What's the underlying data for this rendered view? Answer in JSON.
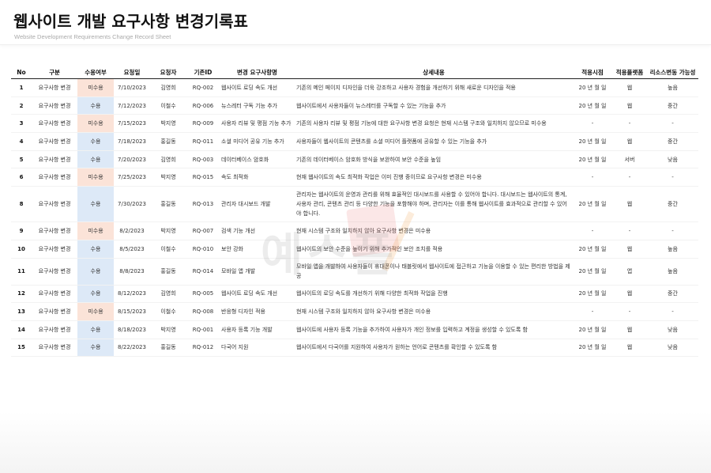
{
  "header": {
    "title": "웹사이트 개발 요구사항 변경기록표",
    "subtitle": "Website Development Requirements Change Record Sheet"
  },
  "watermark": {
    "icon": "yes-form-watermark-logo",
    "text": "예스폼"
  },
  "columns": [
    "No",
    "구분",
    "수용여부",
    "요청일",
    "요청자",
    "기존ID",
    "변경 요구사항명",
    "상세내용",
    "적용시점",
    "적용플랫폼",
    "리소스변동 가능성"
  ],
  "colors": {
    "accepted": "#dde9f7",
    "rejected": "#fbe3d8"
  },
  "rows": [
    {
      "no": "1",
      "type": "요구사항 변경",
      "status": "미수용",
      "accepted": false,
      "date": "7/10/2023",
      "requester": "김영희",
      "id": "RQ-002",
      "name": "웹사이트 로딩 속도 개선",
      "detail": "기존의 메인 페이지 디자인을 더욱 강조하고 사용자 경험을 개선하기 위해 새로운 디자인을 적용",
      "when": "20 년 월 일",
      "platform": "웹",
      "resource": "높음"
    },
    {
      "no": "2",
      "type": "요구사항 변경",
      "status": "수용",
      "accepted": true,
      "date": "7/12/2023",
      "requester": "이철수",
      "id": "RQ-006",
      "name": "뉴스레터 구독 기능 추가",
      "detail": "웹사이트에서 사용자들이 뉴스레터를 구독할 수 있는 기능을 추가",
      "when": "20 년 월 일",
      "platform": "웹",
      "resource": "중간"
    },
    {
      "no": "3",
      "type": "요구사항 변경",
      "status": "미수용",
      "accepted": false,
      "date": "7/15/2023",
      "requester": "박지영",
      "id": "RQ-009",
      "name": "사용자 리뷰 및 평점 기능 추가",
      "detail": "기존의 사용자 리뷰 및 평점 기능에 대한 요구사항 변경 요청은 현재 시스템 구조와 일치하지 않으므로 미수용",
      "when": "-",
      "platform": "-",
      "resource": "-"
    },
    {
      "no": "4",
      "type": "요구사항 변경",
      "status": "수용",
      "accepted": true,
      "date": "7/18/2023",
      "requester": "홍길동",
      "id": "RQ-011",
      "name": "소셜 미디어 공유 기능 추가",
      "detail": "사용자들이 웹사이트의 콘텐츠를 소셜 미디어 플랫폼에 공유할 수 있는 기능을 추가",
      "when": "20 년 월 일",
      "platform": "웹",
      "resource": "중간"
    },
    {
      "no": "5",
      "type": "요구사항 변경",
      "status": "수용",
      "accepted": true,
      "date": "7/20/2023",
      "requester": "김영희",
      "id": "RQ-003",
      "name": "데이터베이스 암호화",
      "detail": "기존의 데이터베이스 암호화 방식을 보완하여 보안 수준을 높임",
      "when": "20 년 월 일",
      "platform": "서버",
      "resource": "낮음"
    },
    {
      "no": "6",
      "type": "요구사항 변경",
      "status": "미수용",
      "accepted": false,
      "date": "7/25/2023",
      "requester": "박지영",
      "id": "RQ-015",
      "name": "속도 최적화",
      "detail": "현재 웹사이트의 속도 최적화 작업은 이미 진행 중이므로 요구사항 변경은 미수용",
      "when": "-",
      "platform": "-",
      "resource": "-"
    },
    {
      "no": "8",
      "type": "요구사항 변경",
      "status": "수용",
      "accepted": true,
      "date": "7/30/2023",
      "requester": "홍길동",
      "id": "RQ-013",
      "name": "관리자 대시보드 개발",
      "detail": "관리자는 웹사이트의 운영과 관리를 위해 효율적인 대시보드를 사용할 수 있어야 합니다. 대시보드는 웹사이트의 통계, 사용자 관리, 콘텐츠 관리 등 다양한 기능을 포함해야 하며, 관리자는 이를 통해 웹사이트를 효과적으로 관리할 수 있어야 합니다.",
      "when": "20 년 월 일",
      "platform": "웹",
      "resource": "중간",
      "tall": true
    },
    {
      "no": "9",
      "type": "요구사항 변경",
      "status": "미수용",
      "accepted": false,
      "date": "8/2/2023",
      "requester": "박지영",
      "id": "RQ-007",
      "name": "검색 기능 개선",
      "detail": "현재 시스템 구조와 일치하지 않아 요구사항 변경은 미수용",
      "when": "-",
      "platform": "-",
      "resource": "-"
    },
    {
      "no": "10",
      "type": "요구사항 변경",
      "status": "수용",
      "accepted": true,
      "date": "8/5/2023",
      "requester": "이철수",
      "id": "RQ-010",
      "name": "보안 강화",
      "detail": "웹사이트의 보안 수준을 높이기 위해 추가적인 보안 조치를 적용",
      "when": "20 년 월 일",
      "platform": "웹",
      "resource": "높음"
    },
    {
      "no": "11",
      "type": "요구사항 변경",
      "status": "수용",
      "accepted": true,
      "date": "8/8/2023",
      "requester": "홍길동",
      "id": "RQ-014",
      "name": "모바일 앱 개발",
      "detail": "모바일 앱을 개발하여 사용자들이 휴대폰이나 태블릿에서 웹사이트에 접근하고 기능을 이용할 수 있는 편리한 방법을 제공",
      "when": "20 년 월 일",
      "platform": "앱",
      "resource": "높음",
      "mid": true
    },
    {
      "no": "12",
      "type": "요구사항 변경",
      "status": "수용",
      "accepted": true,
      "date": "8/12/2023",
      "requester": "김영희",
      "id": "RQ-005",
      "name": "웹사이트 로딩 속도 개선",
      "detail": "웹사이트의 로딩 속도를 개선하기 위해 다양한 최적화 작업을 진행",
      "when": "20 년 월 일",
      "platform": "웹",
      "resource": "중간"
    },
    {
      "no": "13",
      "type": "요구사항 변경",
      "status": "미수용",
      "accepted": false,
      "date": "8/15/2023",
      "requester": "이철수",
      "id": "RQ-008",
      "name": "반응형 디자인 적용",
      "detail": "현재 시스템 구조와 일치하지 않아 요구사항 변경은 미수용",
      "when": "-",
      "platform": "-",
      "resource": "-"
    },
    {
      "no": "14",
      "type": "요구사항 변경",
      "status": "수용",
      "accepted": true,
      "date": "8/18/2023",
      "requester": "박지영",
      "id": "RQ-001",
      "name": "사용자 등록 기능 개발",
      "detail": "웹사이트에 사용자 등록 기능을 추가하여 사용자가 개인 정보를 입력하고 계정을 생성할 수 있도록 함",
      "when": "20 년 월 일",
      "platform": "웹",
      "resource": "낮음"
    },
    {
      "no": "15",
      "type": "요구사항 변경",
      "status": "수용",
      "accepted": true,
      "date": "8/22/2023",
      "requester": "홍길동",
      "id": "RQ-012",
      "name": "다국어 지원",
      "detail": "웹사이트에서 다국어를 지원하여 사용자가 원하는 언어로 콘텐츠를 확인할 수 있도록 함",
      "when": "20 년 월 일",
      "platform": "웹",
      "resource": "낮음"
    }
  ]
}
